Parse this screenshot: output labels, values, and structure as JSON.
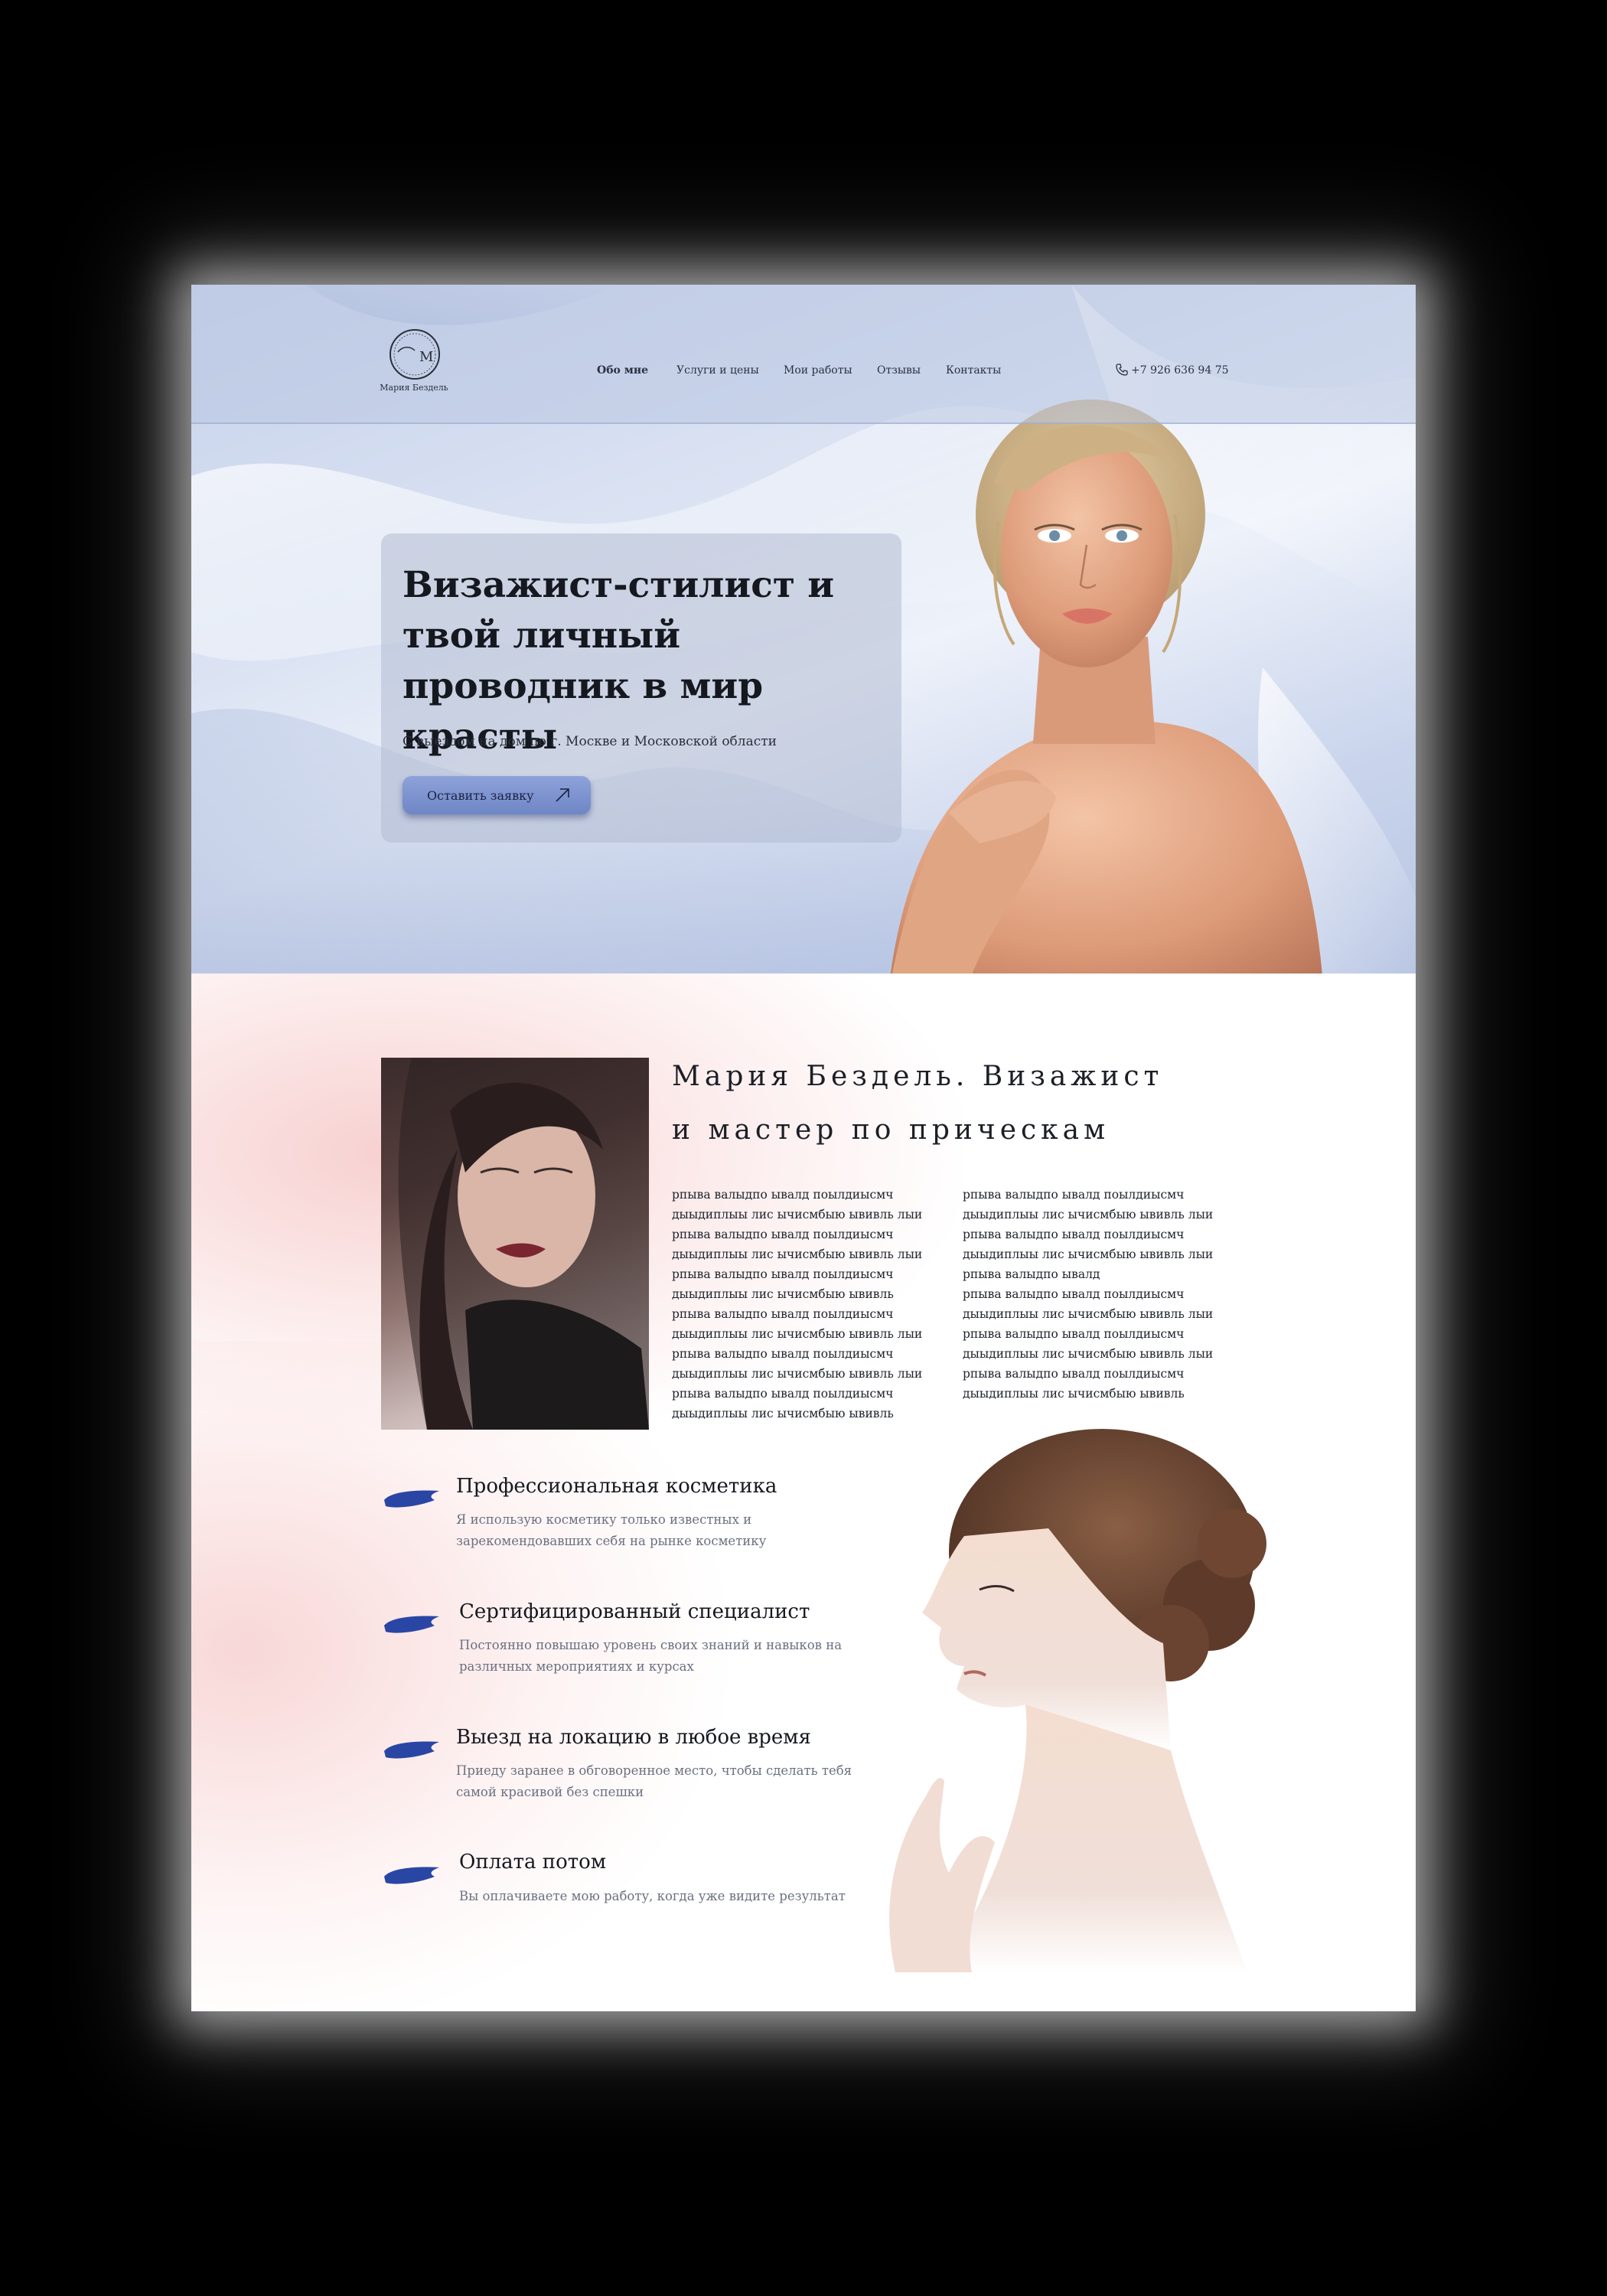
{
  "brand": {
    "name": "Мария Бездель",
    "monogram": "М"
  },
  "nav": {
    "items": [
      "Обо мне",
      "Услуги и цены",
      "Мои работы",
      "Отзывы",
      "Контакты"
    ],
    "active_index": 0
  },
  "phone": "+7 926 636 94 75",
  "hero": {
    "title": "Визажист-стилист и твой личный проводник в мир красты",
    "subtitle": "С выездом на дом по г. Москве и Московской области",
    "cta_label": "Оставить заявку"
  },
  "about": {
    "title_line1": "Мария Бездель. Визажист",
    "title_line2": "и мастер по прическам",
    "column1": "рпыва валыдпо ывалд поылдиысмч\nдыыдиплыы лис ычисмбыю ывивль лыи\nрпыва валыдпо ывалд поылдиысмч\nдыыдиплыы лис ычисмбыю ывивль лыи\nрпыва валыдпо ывалд поылдиысмч\nдыыдиплыы лис ычисмбыю ывивль\nрпыва валыдпо ывалд поылдиысмч\nдыыдиплыы лис ычисмбыю ывивль лыи\nрпыва валыдпо ывалд поылдиысмч\nдыыдиплыы лис ычисмбыю ывивль лыи\nрпыва валыдпо ывалд поылдиысмч\nдыыдиплыы лис ычисмбыю ывивль",
    "column2": "рпыва валыдпо ывалд поылдиысмч\nдыыдиплыы лис ычисмбыю ывивль лыи\nрпыва валыдпо ывалд поылдиысмч\nдыыдиплыы лис ычисмбыю ывивль лыи\nрпыва валыдпо ывалд\nрпыва валыдпо ывалд поылдиысмч\nдыыдиплыы лис ычисмбыю ывивль лыи\nрпыва валыдпо ывалд поылдиысмч\nдыыдиплыы лис ычисмбыю ывивль лыи\nрпыва валыдпо ывалд поылдиысмч\nдыыдиплыы лис ычисмбыю ывивль"
  },
  "features": [
    {
      "title": "Профессиональная косметика",
      "desc": "Я использую косметику только известных и зарекомендовавших себя на рынке косметику"
    },
    {
      "title": "Сертифицированный специалист",
      "desc": "Постоянно повышаю уровень своих знаний и навыков на различных мероприятиях и курсах"
    },
    {
      "title": "Выезд на локацию в любое время",
      "desc": "Приеду заранее в обговоренное место, чтобы сделать тебя самой красивой без спешки"
    },
    {
      "title": "Оплата потом",
      "desc": "Вы оплачиваете мою работу, когда уже видите результат"
    }
  ],
  "colors": {
    "accent_blue": "#2a46a4",
    "blush_pink": "#f6c8c8",
    "hero_blue": "#c9d4ec"
  },
  "icons": {
    "phone": "phone-icon",
    "cta_arrow": "arrow-up-right-icon",
    "feature_marker": "brush-stroke-icon"
  }
}
